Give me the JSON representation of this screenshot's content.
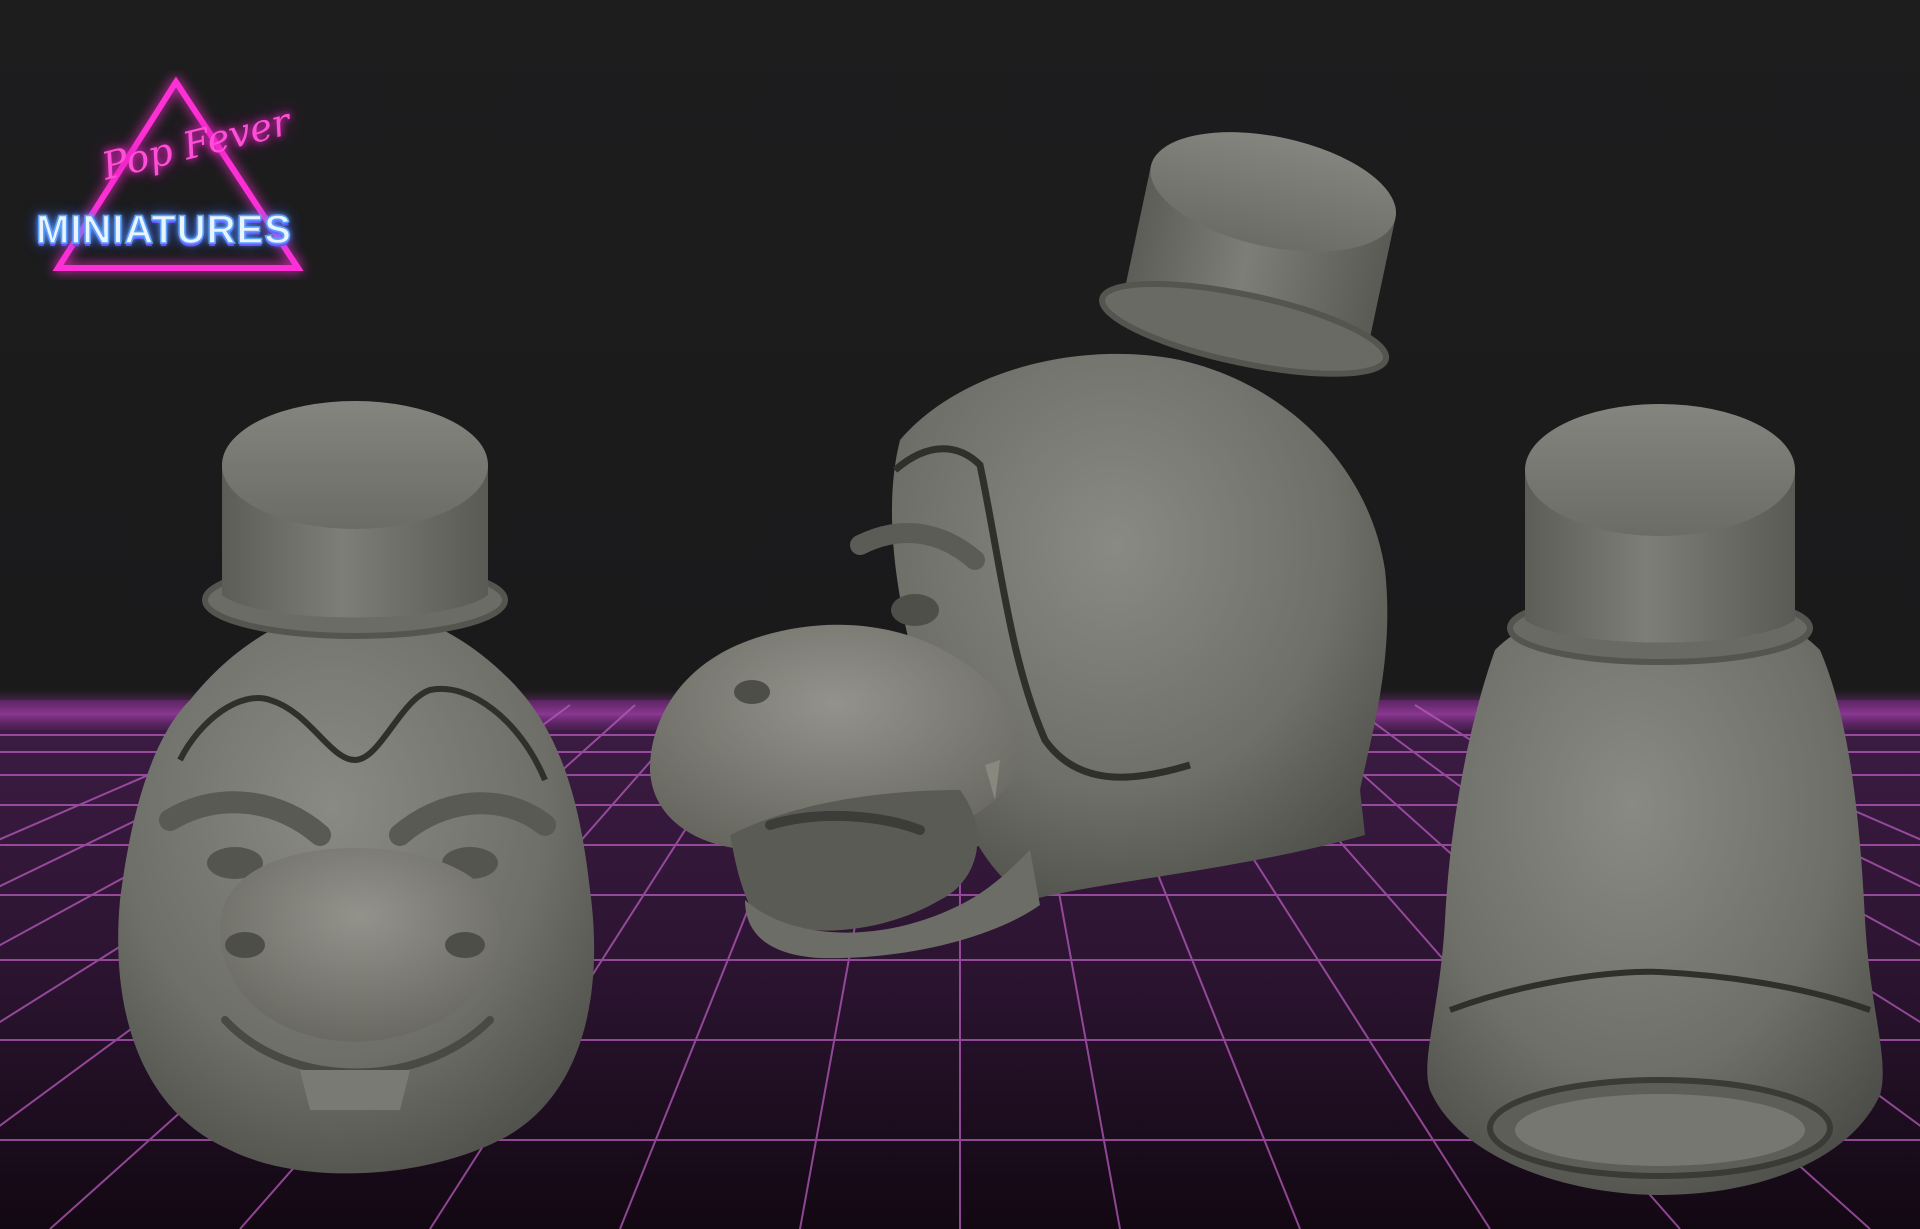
{
  "logo": {
    "script_text": "Pop Fever",
    "wordmark": "MINIATURES",
    "colors": {
      "triangle": "#ff2fd6",
      "script": "#ff4fd8",
      "wordmark": "#e9f4ff",
      "wordmark_glow": "#3c68ff"
    }
  },
  "scene": {
    "background": "#1b1b1c",
    "grid_color": "#c04fc8",
    "floor_color": "#3a1a40",
    "model_color": "#74746e",
    "views": [
      "front-view",
      "side-view",
      "back-view"
    ]
  }
}
